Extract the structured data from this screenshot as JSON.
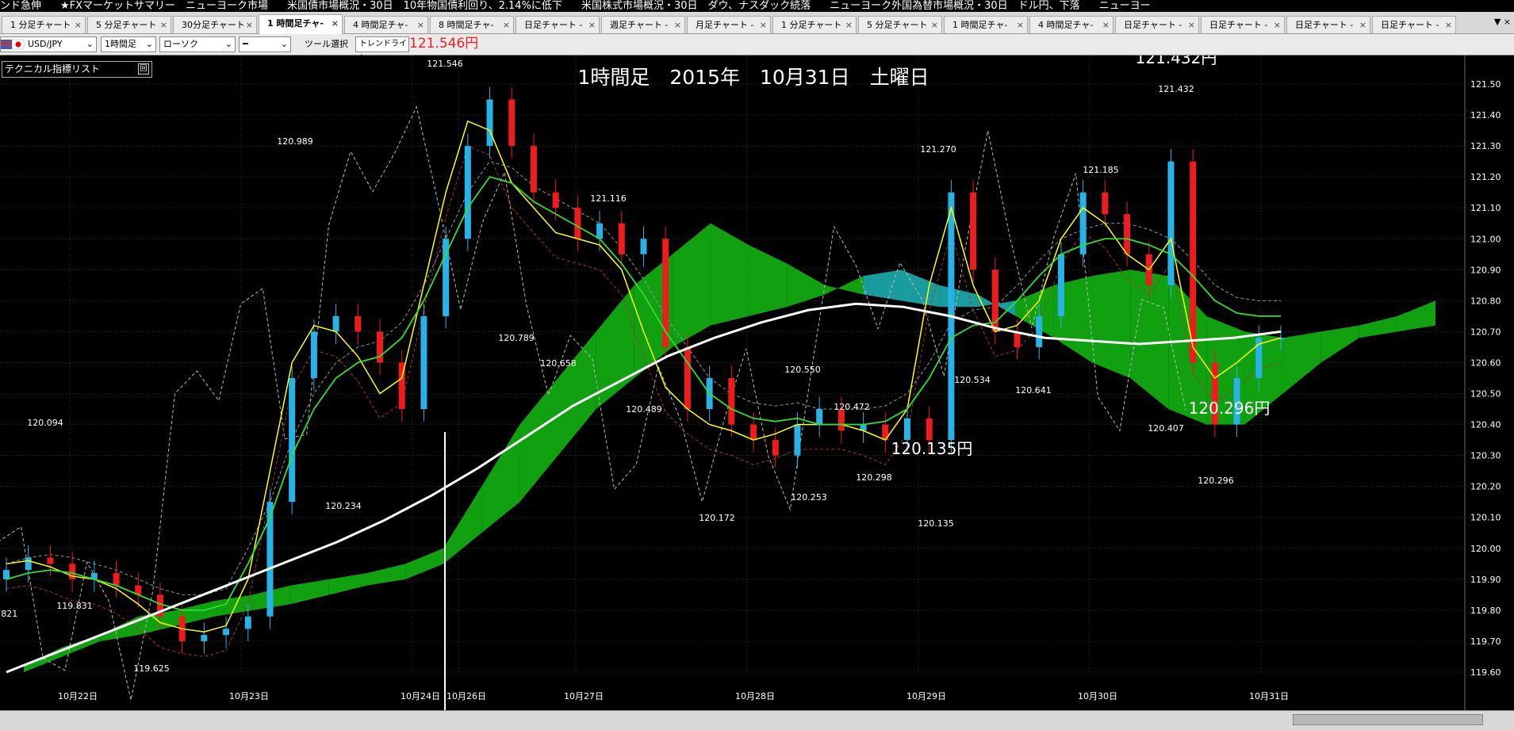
{
  "ticker": [
    "ンド急伸",
    "★FXマーケットサマリー　ニューヨーク市場",
    "米国債市場概況・30日　10年物国債利回り、2.14%に低下",
    "米国株式市場概況・30日　ダウ、ナスダック続落",
    "ニューヨーク外国為替市場概況・30日　ドル円、下落",
    "ニューヨー"
  ],
  "tabs": [
    {
      "label": "1 分足チャート",
      "active": false
    },
    {
      "label": "5 分足チャート",
      "active": false
    },
    {
      "label": "30分足チャート",
      "active": false
    },
    {
      "label": "1 時間足チャ-",
      "active": true
    },
    {
      "label": "4 時間足チャ-",
      "active": false
    },
    {
      "label": "8 時間足チャ-",
      "active": false
    },
    {
      "label": "日足チャート -",
      "active": false
    },
    {
      "label": "週足チャート -",
      "active": false
    },
    {
      "label": "月足チャート -",
      "active": false
    },
    {
      "label": "1 分足チャート",
      "active": false
    },
    {
      "label": "5 分足チャート",
      "active": false
    },
    {
      "label": "1 時間足チャ-",
      "active": false
    },
    {
      "label": "4 時間足チャ-",
      "active": false
    },
    {
      "label": "日足チャート -",
      "active": false
    },
    {
      "label": "日足チャート -",
      "active": false
    },
    {
      "label": "日足チャート -",
      "active": false
    },
    {
      "label": "日足チャート -",
      "active": false
    }
  ],
  "tab_close": "×",
  "toolbar": {
    "pair": "USD/JPY",
    "timeframe": "1時間足",
    "chart_type": "ローソク",
    "line_style": "━",
    "tool_select": "ツール選択",
    "trendline": "トレンドライン",
    "current_price": "121.546円"
  },
  "tech_list": {
    "label": "テクニカル指標リスト",
    "button": "回"
  },
  "chart": {
    "title": "1時間足　2015年　10月31日　土曜日",
    "colors": {
      "up": "#27b3e6",
      "down": "#ee1c1c",
      "ichimoku_bull": "#10a010",
      "ichimoku_bear": "#1a9c9e",
      "ma_fast": "#ffff00",
      "ma_mid": "#33dd33",
      "ma_slow": "#ffffff"
    },
    "y_axis": {
      "min": 119.6,
      "max": 121.5,
      "ticks": [
        "121.50",
        "121.40",
        "121.30",
        "121.20",
        "121.10",
        "121.00",
        "120.90",
        "120.80",
        "120.70",
        "120.60",
        "120.50",
        "120.40",
        "120.30",
        "120.20",
        "120.10",
        "120.00",
        "119.90",
        "119.80",
        "119.70",
        "119.60"
      ]
    },
    "x_axis": [
      "10月22日",
      "10月23日",
      "10月24日",
      "10月26日",
      "10月27日",
      "10月28日",
      "10月29日",
      "10月30日",
      "10月31日"
    ],
    "price_labels": [
      "121.546",
      "120.989",
      "121.116",
      "121.270",
      "121.185",
      "121.432",
      "120.094",
      "119.831",
      "119.625",
      "120.234",
      "120.789",
      "120.658",
      "120.489",
      "120.172",
      "120.550",
      "120.253",
      "120.472",
      "120.298",
      "120.135",
      "120.534",
      "120.641",
      "120.407",
      "120.296",
      ".821"
    ],
    "annotations": [
      "121.432円",
      "120.135円",
      "120.296円"
    ],
    "series": [
      {
        "name": "ローソク",
        "values": [
          119.93,
          119.97,
          119.95,
          119.9,
          119.92,
          119.88,
          119.85,
          119.78,
          119.7,
          119.72,
          119.74,
          119.78,
          120.15,
          120.55,
          120.7,
          120.75,
          120.7,
          120.6,
          120.45,
          120.75,
          121.0,
          121.3,
          121.45,
          121.3,
          121.15,
          121.1,
          121.0,
          121.05,
          120.95,
          121.0,
          120.65,
          120.45,
          120.55,
          120.4,
          120.35,
          120.3,
          120.4,
          120.45,
          120.38,
          120.4,
          120.35,
          120.42,
          120.35,
          121.15,
          120.9,
          120.7,
          120.65,
          120.75,
          120.95,
          121.15,
          121.08,
          120.95,
          120.85,
          121.25,
          120.6,
          120.4,
          120.55,
          120.68,
          120.68
        ]
      },
      {
        "name": "移動平均",
        "values": [
          119.95,
          119.96,
          119.94,
          119.91,
          119.9,
          119.87,
          119.82,
          119.76,
          119.74,
          119.73,
          119.75,
          119.9,
          120.25,
          120.6,
          120.72,
          120.7,
          120.62,
          120.5,
          120.55,
          120.85,
          121.15,
          121.38,
          121.35,
          121.18,
          121.1,
          121.02,
          121.0,
          120.98,
          120.9,
          120.7,
          120.52,
          120.45,
          120.4,
          120.38,
          120.35,
          120.37,
          120.4,
          120.4,
          120.4,
          120.38,
          120.35,
          120.45,
          120.85,
          121.1,
          120.85,
          120.7,
          120.72,
          120.8,
          121.0,
          121.1,
          121.05,
          120.95,
          120.9,
          121.0,
          120.65,
          120.55,
          120.6,
          120.66,
          120.68
        ]
      },
      {
        "name": "移動平均2",
        "values": [
          119.9,
          119.92,
          119.93,
          119.92,
          119.9,
          119.88,
          119.85,
          119.82,
          119.8,
          119.8,
          119.82,
          119.95,
          120.1,
          120.3,
          120.45,
          120.55,
          120.6,
          120.62,
          120.68,
          120.8,
          120.95,
          121.1,
          121.2,
          121.18,
          121.12,
          121.08,
          121.04,
          121.0,
          120.92,
          120.82,
          120.7,
          120.6,
          120.5,
          120.45,
          120.42,
          120.41,
          120.42,
          120.4,
          120.4,
          120.4,
          120.41,
          120.45,
          120.55,
          120.68,
          120.72,
          120.73,
          120.8,
          120.88,
          120.95,
          120.98,
          121.0,
          121.0,
          120.98,
          120.95,
          120.88,
          120.8,
          120.76,
          120.75,
          120.75
        ]
      },
      {
        "name": "移動平均3",
        "values": [
          119.6,
          119.66,
          119.72,
          119.78,
          119.84,
          119.9,
          119.96,
          120.02,
          120.09,
          120.17,
          120.26,
          120.36,
          120.46,
          120.54,
          120.62,
          120.68,
          120.73,
          120.77,
          120.79,
          120.78,
          120.75,
          120.71,
          120.68,
          120.67,
          120.66,
          120.67,
          120.68,
          120.7
        ]
      }
    ]
  }
}
